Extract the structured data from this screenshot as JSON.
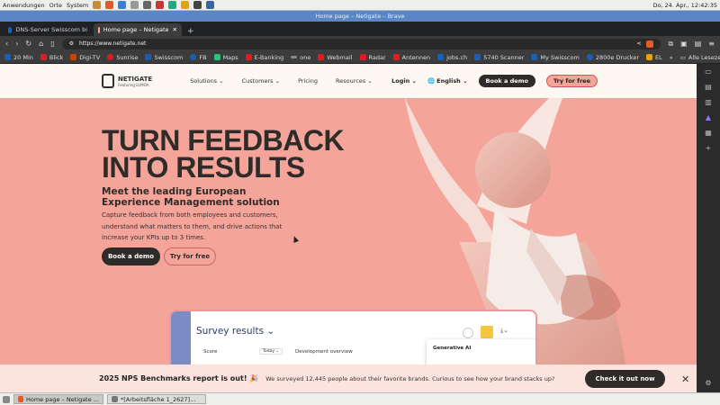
{
  "system": {
    "menu": [
      "Anwendungen",
      "Orte",
      "System"
    ],
    "clock": "Do, 24. Apr., 12:42:35"
  },
  "window": {
    "title": "Home page – Netigate – Brave"
  },
  "tabs": [
    {
      "label": "DNS-Server Swisscom bi",
      "active": false
    },
    {
      "label": "Home page – Netigate",
      "active": true
    }
  ],
  "tab_new": "+",
  "url": "https://www.netigate.net",
  "bookmarks": [
    {
      "label": "20 Min",
      "color": "#1a5fb4"
    },
    {
      "label": "Blick",
      "color": "#e01b24"
    },
    {
      "label": "Digi-TV",
      "color": "#c64600"
    },
    {
      "label": "Sunrise",
      "color": "#e01b24"
    },
    {
      "label": "Swisscom",
      "color": "#1a5fb4"
    },
    {
      "label": "FB",
      "color": "#1a5fb4"
    },
    {
      "label": "Maps",
      "color": "#2ec27e"
    },
    {
      "label": "E-Banking",
      "color": "#e01b24"
    },
    {
      "label": "one",
      "color": "#888888"
    },
    {
      "label": "Webmail",
      "color": "#e01b24"
    },
    {
      "label": "Radar",
      "color": "#e01b24"
    },
    {
      "label": "Antennen",
      "color": "#e01b24"
    },
    {
      "label": "jobs.ch",
      "color": "#1a5fb4"
    },
    {
      "label": "5740 Scanner",
      "color": "#1a5fb4"
    },
    {
      "label": "My Swisscom",
      "color": "#1a5fb4"
    },
    {
      "label": "2800e Drucker",
      "color": "#1a5fb4"
    },
    {
      "label": "EL",
      "color": "#e5a50a"
    }
  ],
  "bookmarks_more": "»",
  "bookmarks_all": "Alle Lesezeichen",
  "site": {
    "logo": "NETIGATE",
    "logo_sub": "Featuring LUMOA",
    "nav": [
      "Solutions ⌄",
      "Customers ⌄",
      "Pricing",
      "Resources ⌄"
    ],
    "login": "Login ⌄",
    "language": "English ⌄",
    "book_demo": "Book a demo",
    "try_free": "Try for free"
  },
  "hero": {
    "headline_1": "TURN FEEDBACK",
    "headline_2": "INTO RESULTS",
    "sub_1": "Meet the leading European",
    "sub_2": "Experience Management solution",
    "body_1": "Capture feedback from both employees and customers,",
    "body_2": "understand what matters to them, and drive actions that",
    "body_3": "increase your KPIs up to 3 times.",
    "cta_primary": "Book a demo",
    "cta_secondary": "Try for free"
  },
  "card": {
    "title": "Survey results ⌄",
    "score": "Score",
    "today": "Today ⌄",
    "development": "Development overview",
    "generative": "Generative AI"
  },
  "banner": {
    "title": "2025 NPS Benchmarks report is out! 🎉",
    "text": "We surveyed 12,445 people about their favorite brands. Curious to see how your brand stacks up?",
    "button": "Check it out now",
    "close": "✕"
  },
  "taskbar": [
    {
      "label": "Home page – Netigate ..."
    },
    {
      "label": "*[Arbeitsfläche 1_2627]..."
    }
  ]
}
